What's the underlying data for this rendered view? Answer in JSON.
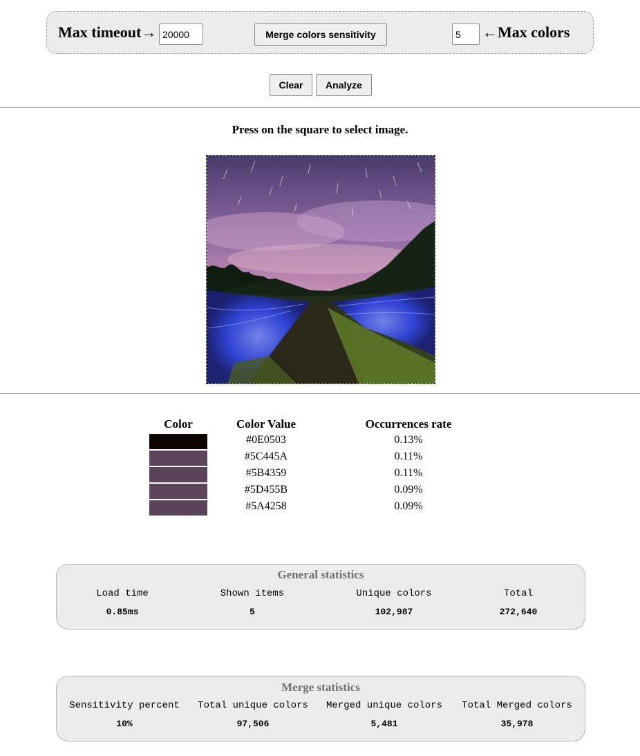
{
  "controls": {
    "max_timeout_label": "Max timeout→",
    "max_timeout_value": "20000",
    "merge_button_label": "Merge colors sensitivity",
    "max_colors_value": "5",
    "max_colors_label": "←Max colors"
  },
  "actions": {
    "clear_label": "Clear",
    "analyze_label": "Analyze"
  },
  "instruction": "Press on the square to select image.",
  "color_table": {
    "headers": [
      "Color",
      "Color Value",
      "Occurrences rate"
    ],
    "rows": [
      {
        "color": "#0E0503",
        "value": "#0E0503",
        "rate": "0.13%"
      },
      {
        "color": "#5C445A",
        "value": "#5C445A",
        "rate": "0.11%"
      },
      {
        "color": "#5B4359",
        "value": "#5B4359",
        "rate": "0.11%"
      },
      {
        "color": "#5D455B",
        "value": "#5D455B",
        "rate": "0.09%"
      },
      {
        "color": "#5A4258",
        "value": "#5A4258",
        "rate": "0.09%"
      }
    ]
  },
  "general_stats": {
    "title": "General statistics",
    "items": [
      {
        "label": "Load time",
        "value": "0.85ms"
      },
      {
        "label": "Shown items",
        "value": "5"
      },
      {
        "label": "Unique colors",
        "value": "102,987"
      },
      {
        "label": "Total",
        "value": "272,640"
      }
    ]
  },
  "merge_stats": {
    "title": "Merge statistics",
    "items": [
      {
        "label": "Sensitivity percent",
        "value": "10%"
      },
      {
        "label": "Total unique colors",
        "value": "97,506"
      },
      {
        "label": "Merged unique colors",
        "value": "5,481"
      },
      {
        "label": "Total Merged colors",
        "value": "35,978"
      }
    ]
  }
}
